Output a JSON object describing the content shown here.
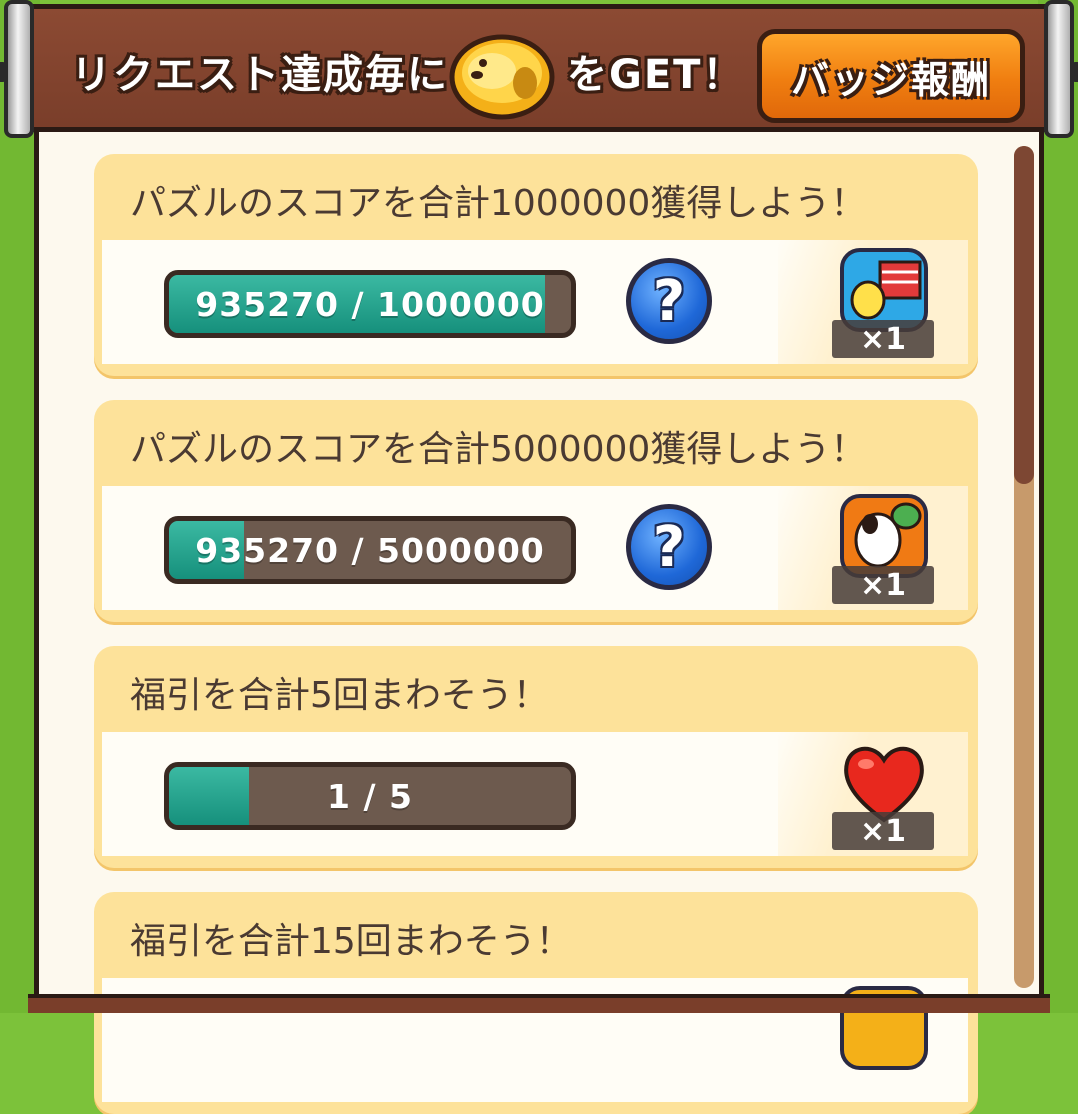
{
  "banner": {
    "text_before": "リクエスト達成毎に",
    "text_after": "をGET！",
    "badge_button": "バッジ報酬"
  },
  "requests": [
    {
      "title": "パズルのスコアを合計1000000獲得しよう！",
      "progress_text": "935270 / 1000000",
      "progress_fraction": 0.935,
      "has_help": true,
      "reward_icon": "woodstock-item-icon",
      "reward_qty": "×1"
    },
    {
      "title": "パズルのスコアを合計5000000獲得しよう！",
      "progress_text": "935270 / 5000000",
      "progress_fraction": 0.187,
      "has_help": true,
      "reward_icon": "snoopy-item-icon",
      "reward_qty": "×1"
    },
    {
      "title": "福引を合計5回まわそう！",
      "progress_text": "1 / 5",
      "progress_fraction": 0.2,
      "has_help": false,
      "reward_icon": "heart-icon",
      "reward_qty": "×1"
    },
    {
      "title": "福引を合計15回まわそう！"
    }
  ],
  "help_label": "?",
  "colors": {
    "progress": "#1fa08b",
    "card": "#fde29a",
    "banner": "#7a3e2a"
  }
}
